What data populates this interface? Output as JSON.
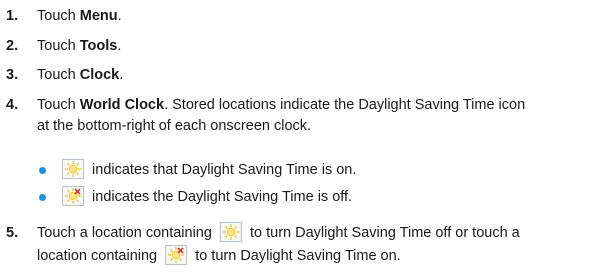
{
  "steps": [
    {
      "num": "1.",
      "pre": "Touch ",
      "bold": "Menu",
      "post": "."
    },
    {
      "num": "2.",
      "pre": "Touch ",
      "bold": "Tools",
      "post": "."
    },
    {
      "num": "3.",
      "pre": "Touch ",
      "bold": "Clock",
      "post": "."
    },
    {
      "num": "4.",
      "pre": "Touch ",
      "bold": "World Clock",
      "post": ". Stored locations indicate the Daylight Saving Time icon",
      "line2": "at the bottom-right of each onscreen clock."
    },
    {
      "num": "5.",
      "a": "Touch a location containing",
      "b": "to turn Daylight Saving Time off or touch a",
      "c": "location containing",
      "d": "to turn Daylight Saving Time on."
    }
  ],
  "bullets": [
    {
      "text": "indicates that Daylight Saving Time is on.",
      "icon": "dst-on-icon"
    },
    {
      "text": "indicates the Daylight Saving Time is off.",
      "icon": "dst-off-icon"
    }
  ],
  "colors": {
    "bullet": "#1e90e0",
    "sun": "#f6c72a",
    "cross": "#d93a2b"
  }
}
